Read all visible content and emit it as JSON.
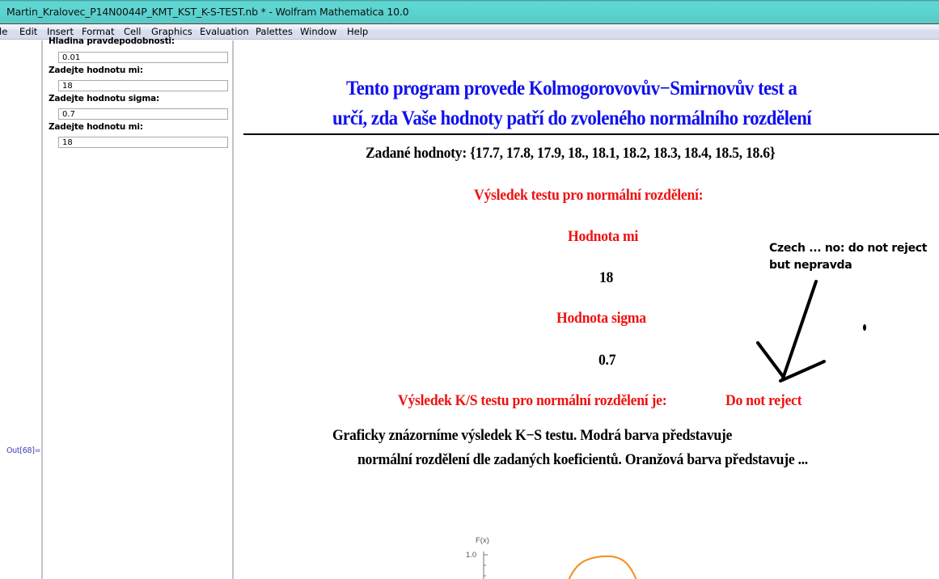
{
  "window": {
    "title": "Martin_Kralovec_P14N0044P_KMT_KST_K-S-TEST.nb * - Wolfram Mathematica 10.0"
  },
  "menu": {
    "items": [
      "le",
      "Edit",
      "Insert",
      "Format",
      "Cell",
      "Graphics",
      "Evaluation",
      "Palettes",
      "Window",
      "Help"
    ]
  },
  "controls": [
    {
      "label": "Hladina pravdepodobnosti:",
      "value": "0.01"
    },
    {
      "label": "Zadejte hodnotu mi:",
      "value": "18"
    },
    {
      "label": "Zadejte hodnotu sigma:",
      "value": "0.7"
    },
    {
      "label": "Zadejte hodnotu mi:",
      "value": "18"
    }
  ],
  "cell_label": "Out[68]=",
  "notebook": {
    "title_line1": "Tento program provede Kolmogorovovův−Smirnovův test a",
    "title_line2": "určí, zda Vaše hodnoty patří do zvoleného normálního rozdělení",
    "given_values": "Zadané hodnoty: {17.7, 17.8, 17.9, 18., 18.1, 18.2, 18.3, 18.4, 18.5, 18.6}",
    "result_heading": "Výsledek testu pro normální rozdělení:",
    "mi_label": "Hodnota mi",
    "mi_value": "18",
    "sigma_label": "Hodnota sigma",
    "sigma_value": "0.7",
    "ks_result_label": "Výsledek K/S testu pro normální rozdělení je:",
    "ks_result_value": "Do not reject",
    "description_line1": "Graficky znázorníme výsledek K−S testu. Modrá barva představuje",
    "description_line2": "normální rozdělení dle zadaných koeficientů. Oranžová barva představuje ..."
  },
  "annotation": {
    "line1": "Czech ... no: do not reject",
    "line2": "but nepravda"
  },
  "chart": {
    "ylabel": "F(x)",
    "ytick_top": "1.0",
    "curve_color": "#f28e1c"
  }
}
